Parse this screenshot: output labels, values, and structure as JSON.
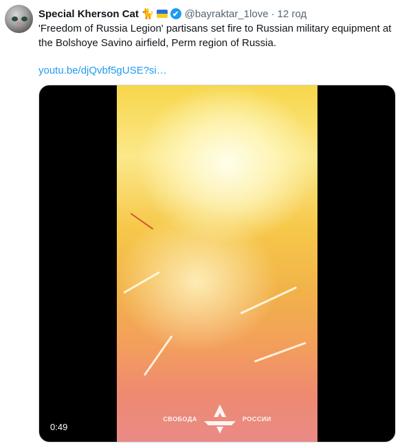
{
  "tweet": {
    "author_name": "Special Kherson Cat",
    "author_emoji": "🐈",
    "handle": "@bayraktar_1love",
    "separator": "·",
    "time": "12 год",
    "text": "'Freedom of Russia Legion' partisans set fire to Russian military equipment at the Bolshoye Savino airfield, Perm region of Russia.",
    "link": "youtu.be/djQvbf5gUSE?si…",
    "verified_icon": "✔",
    "flag_colors": {
      "top": "#2b6fd6",
      "bottom": "#f5cf1f"
    },
    "accent": "#1d9bf0"
  },
  "video": {
    "duration": "0:49",
    "watermark_left": "СВОБОДА",
    "watermark_right": "РОССИИ"
  }
}
